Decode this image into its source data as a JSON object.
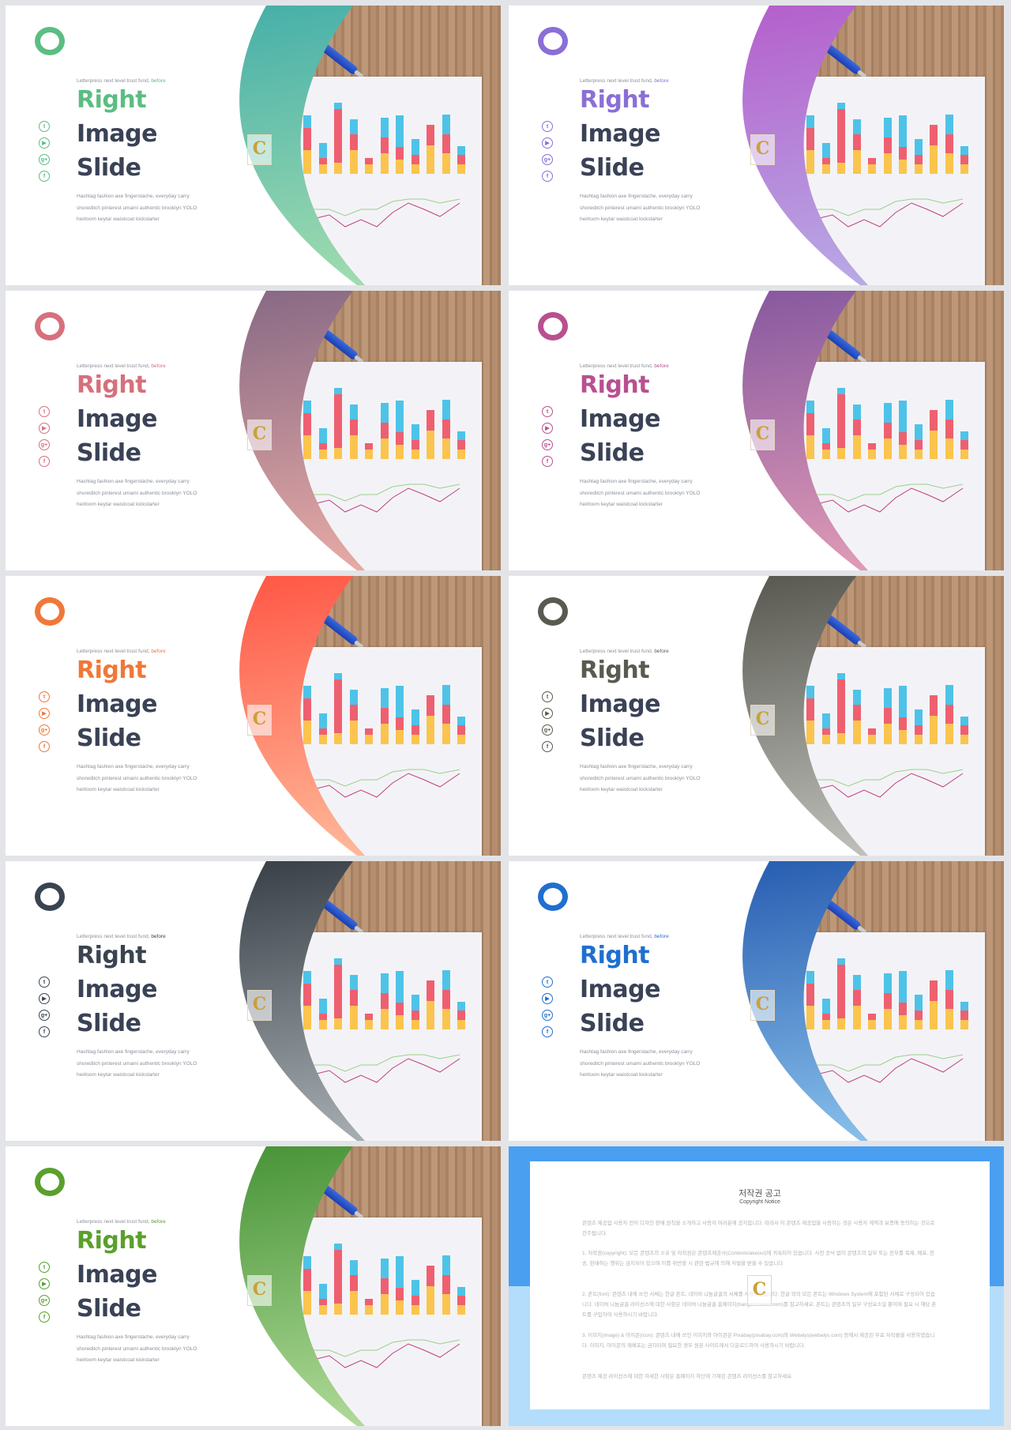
{
  "slide_text": {
    "tagline": "Letterpress next level trust fund,",
    "tagline_accent": "before",
    "title_1": "Right",
    "title_2": "Image",
    "title_3": "Slide",
    "body_1": "Hashtag fashion axe fingerstache, everyday carry",
    "body_2": "shoreditch pinterest umami authentic brooklyn YOLO",
    "body_3": "heirloom  keytar waistcoat kickstarter",
    "watermark": "C"
  },
  "social_icons": [
    {
      "name": "twitter-icon",
      "glyph": "t"
    },
    {
      "name": "youtube-icon",
      "glyph": "▶"
    },
    {
      "name": "google-plus-icon",
      "glyph": "g+"
    },
    {
      "name": "facebook-icon",
      "glyph": "f"
    }
  ],
  "themes": [
    {
      "accent": "#5cbd82",
      "band_top": "#3aa9a8",
      "band_bottom": "#a8e0b0"
    },
    {
      "accent": "#8a6fd6",
      "band_top": "#b455c8",
      "band_bottom": "#b8b0e8"
    },
    {
      "accent": "#d6707c",
      "band_top": "#7a6080",
      "band_bottom": "#f0b0a8"
    },
    {
      "accent": "#b85090",
      "band_top": "#7a4f9c",
      "band_bottom": "#e8a0b8"
    },
    {
      "accent": "#f07838",
      "band_top": "#ff4a3a",
      "band_bottom": "#ffc0a0"
    },
    {
      "accent": "#5a5a50",
      "band_top": "#4a4a42",
      "band_bottom": "#c8c8c4"
    },
    {
      "accent": "#3a4450",
      "band_top": "#2a3038",
      "band_bottom": "#b0b8bc"
    },
    {
      "accent": "#1f6fd0",
      "band_top": "#1a4fa8",
      "band_bottom": "#90c8f0"
    },
    {
      "accent": "#5aa02c",
      "band_top": "#3a8a2a",
      "band_bottom": "#b8e0a0"
    }
  ],
  "copyright": {
    "title": "저작권 공고",
    "subtitle": "Copyright Notice",
    "intro": "콘텐츠 제공업 사용자 전이 디자인 판매 원칙을 소개하고 사용자 여러분께 공지합니다. 따라서 이 콘텐츠 제공업을 사용하는 것은 사용자 계약과 보증에 동의하는 것으로 간주됩니다.",
    "p1": "1. 저작권(copyright): 모든 콘텐츠의 소유 및 저작권은 콘텐츠제공사(Contentslakeout)에 귀속되어 있습니다. 사전 승낙 없이 콘텐츠의 일부 또는 전부를 복제, 배포, 전송, 판매하는 행위는 금지되어 있으며 이를 위반할 시 관련 법규에 의해 처벌을 받을 수 있습니다.",
    "p2": "2. 폰트(font): 콘텐츠 내에 쓰인 서체는 한글 폰트, 네이버 나눔글꼴의 서체를 사용하였습니다. 한글 외의 모든 폰트는 Windows System에 포함된 서체로 구성되어 있습니다. 네이버 나눔글꼴 라이선스에 대한 사항은 네이버 나눔글꼴 홈페이지(hangeul.naver.com)를 참고하세요. 폰트는 콘텐츠의 일부 구성요소일 뿐이며 필요 시 해당 폰트를 구입하여 사용하시기 바랍니다.",
    "p3": "3. 이미지(image) & 아이콘(icon): 콘텐츠 내에 쓰인 이미지와 아이콘은 Pixabay(pixabay.com)와 Webalys(webalys.com) 등에서 제공된 무료 저작물을 사용하였습니다. 이미지, 아이콘의 재배포는 금지되며 필요한 경우 원본 사이트에서 다운로드하여 사용하시기 바랍니다.",
    "outro": "콘텐츠 제공 라이선스에 대한 자세한 사항은 홈페이지 하단에 기재된 콘텐츠 라이선스를 참고하세요."
  }
}
